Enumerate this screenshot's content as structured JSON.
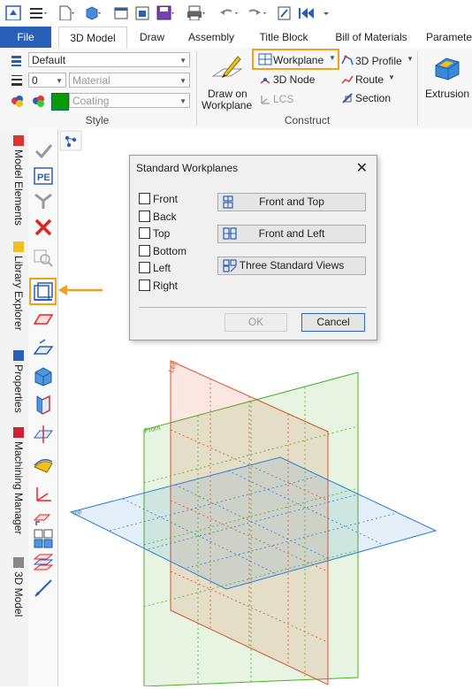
{
  "ribbon_tabs": [
    "File",
    "3D Model",
    "Draw",
    "Assembly",
    "Title Block",
    "Bill of Materials",
    "Paramete"
  ],
  "style_group": {
    "layer_value": "Default",
    "pen_value": "0",
    "material_placeholder": "Material",
    "coating_placeholder": "Coating",
    "label": "Style"
  },
  "construct_group": {
    "draw_on_workplane_line1": "Draw on",
    "draw_on_workplane_line2": "Workplane",
    "workplane": "Workplane",
    "node3d": "3D Node",
    "lcs": "LCS",
    "profile3d": "3D Profile",
    "route": "Route",
    "section": "Section",
    "label": "Construct"
  },
  "extrusion": "Extrusion",
  "side_tabs": [
    "Model Elements",
    "Library Explorer",
    "Properties",
    "Machining Manager",
    "3D Model"
  ],
  "dialog": {
    "title": "Standard Workplanes",
    "checkboxes": [
      "Front",
      "Back",
      "Top",
      "Bottom",
      "Left",
      "Right"
    ],
    "buttons": [
      "Front and Top",
      "Front and Left",
      "Three Standard Views"
    ],
    "ok": "OK",
    "cancel": "Cancel"
  },
  "plane_labels": {
    "left": "Left",
    "front": "Front",
    "top": "Top"
  },
  "colors": {
    "accent": "#f0a21a",
    "file_tab": "#2a5fb8",
    "front_plane": "#4caf27",
    "left_plane": "#d9532c",
    "top_plane": "#2b7fd8"
  }
}
